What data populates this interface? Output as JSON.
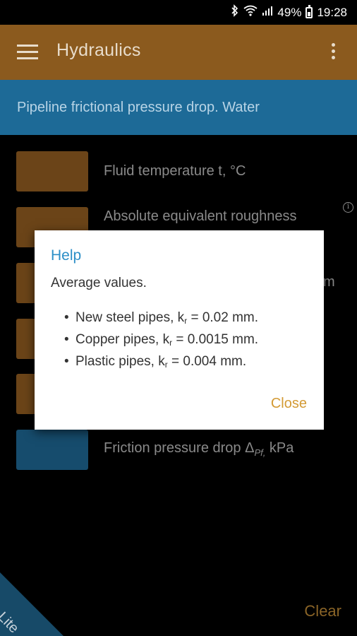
{
  "status_bar": {
    "battery_percent": "49%",
    "time": "19:28"
  },
  "app_bar": {
    "title": "Hydraulics"
  },
  "subtitle": "Pipeline frictional pressure drop. Water",
  "rows": [
    {
      "label": "Fluid temperature t, °C",
      "color": "brown"
    },
    {
      "label": "Absolute equivalent roughness",
      "color": "brown"
    },
    {
      "label": "m",
      "color": "brown"
    },
    {
      "label": "",
      "color": "brown"
    },
    {
      "label": "",
      "color": "brown"
    },
    {
      "label": "Friction pressure drop Δ",
      "sub": "Pf,",
      "unit": " kPa",
      "color": "blue"
    }
  ],
  "footer": {
    "lite_label": "Lite",
    "clear_label": "Clear"
  },
  "dialog": {
    "title": "Help",
    "intro": "Average values.",
    "items": [
      {
        "prefix": "New steel pipes, k",
        "sub": "r",
        "suffix": " = 0.02 mm."
      },
      {
        "prefix": "Copper pipes, k",
        "sub": "r",
        "suffix": " = 0.0015 mm."
      },
      {
        "prefix": "Plastic pipes, k",
        "sub": "r",
        "suffix": " = 0.004 mm."
      }
    ],
    "close_label": "Close"
  },
  "colors": {
    "app_bar": "#8b5a1e",
    "sub_band": "#1d6a97",
    "accent": "#d39a34",
    "dialog_title": "#2c8fc7"
  }
}
